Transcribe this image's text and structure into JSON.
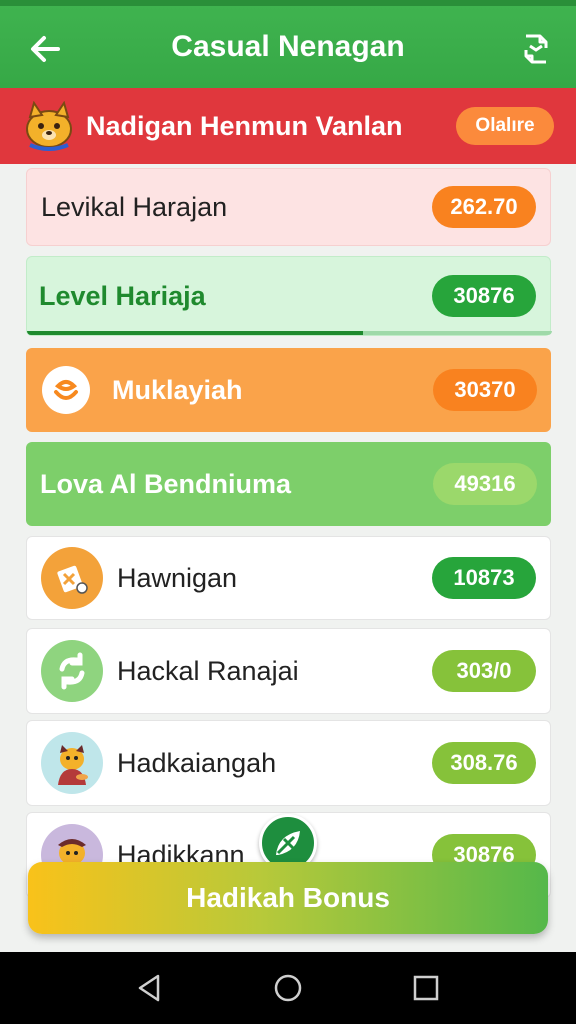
{
  "header": {
    "title": "Casual Nenagan"
  },
  "banner": {
    "text": "Nadigan Henmun Vanlan",
    "pill": "Olalıre"
  },
  "rows": [
    {
      "label": "Levikal Harajan",
      "value": "262.70",
      "bg": "#fde3e3",
      "text_color": "#222222",
      "pill_color": "#f9821f"
    },
    {
      "label": "Level Hariaja",
      "value": "30876",
      "bg": "#d7f5dc",
      "text_color": "#1f8a2e",
      "pill_color": "#27a53b",
      "progress": 0.64
    },
    {
      "label": "Muklayiah",
      "value": "30370",
      "bg": "#faa34a",
      "text_color": "#ffffff",
      "pill_color": "#f9821f"
    },
    {
      "label": "Lova Al Bendniuma",
      "value": "49316",
      "bg": "#7dcf6a",
      "text_color": "#ffffff",
      "pill_color": "#9bd86b"
    },
    {
      "label": "Hawnigan",
      "value": "10873",
      "bg": "#ffffff",
      "text_color": "#222222",
      "pill_color": "#27a53b",
      "icon": "ticket-icon"
    },
    {
      "label": "Hackal Ranajai",
      "value": "303/0",
      "bg": "#ffffff",
      "text_color": "#222222",
      "pill_color": "#86c23a",
      "icon": "refresh-icon"
    },
    {
      "label": "Hadkaiangah",
      "value": "308.76",
      "bg": "#ffffff",
      "text_color": "#222222",
      "pill_color": "#86c23a",
      "icon": "character-icon"
    },
    {
      "label": "Hadikkann",
      "value": "30876",
      "bg": "#ffffff",
      "text_color": "#222222",
      "pill_color": "#86c23a",
      "icon": "character-icon"
    }
  ],
  "bottom_button": {
    "label": "Hadikah Bonus"
  },
  "colors": {
    "header": "#3aad4a",
    "banner": "#e0373d"
  }
}
